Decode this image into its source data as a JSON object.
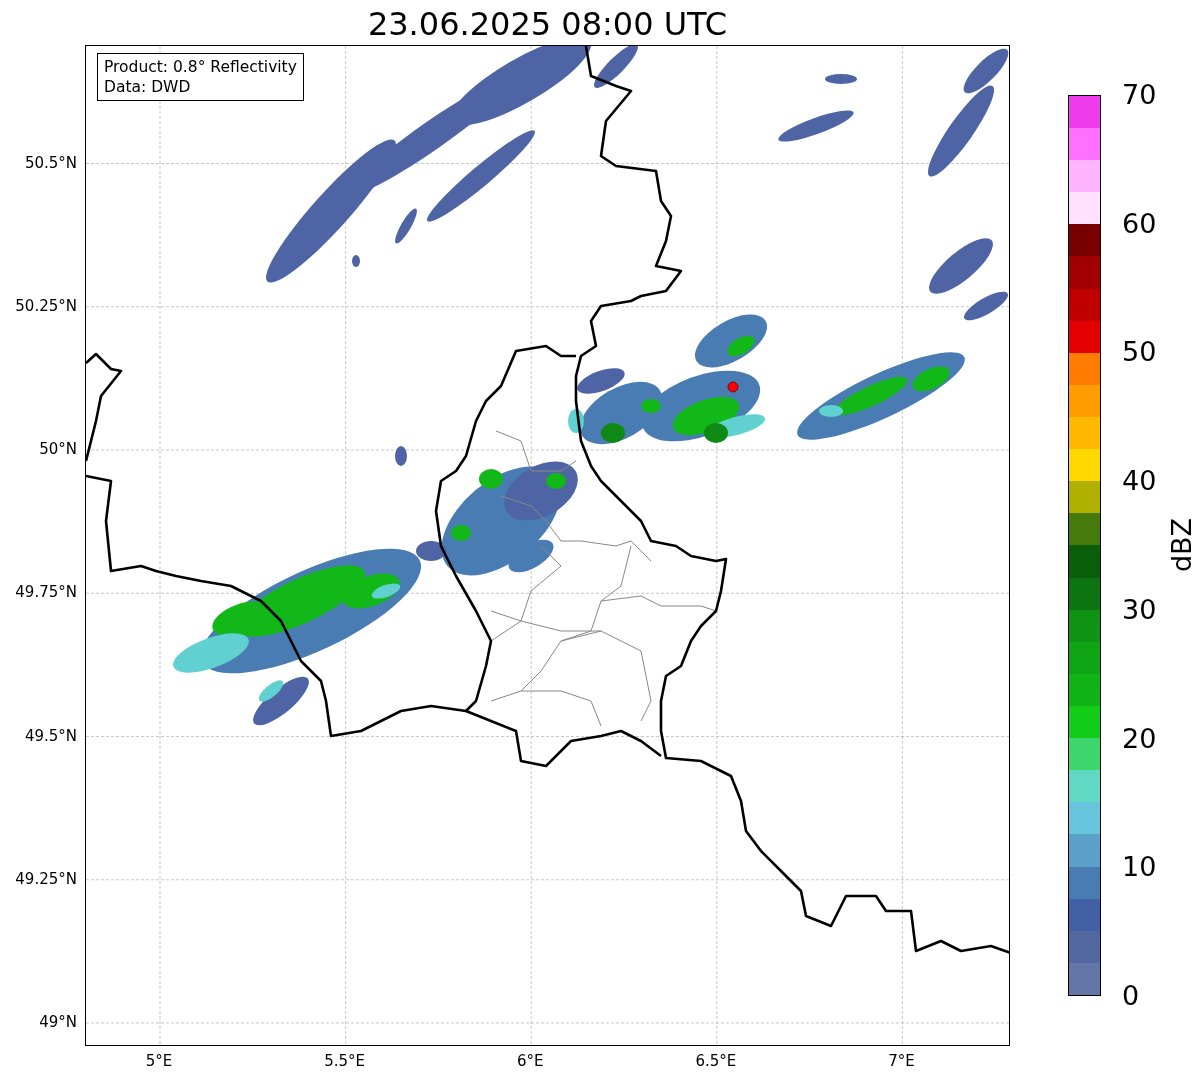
{
  "title": "23.06.2025 08:00 UTC",
  "info_box": {
    "lines": [
      "Product: 0.8° Reflectivity",
      "Data: DWD"
    ]
  },
  "map": {
    "lat_labels": [
      "50.5°N",
      "50.25°N",
      "50°N",
      "49.75°N",
      "49.5°N",
      "49.25°N",
      "49°N"
    ],
    "lon_labels": [
      "5°E",
      "5.5°E",
      "6°E",
      "6.5°E",
      "7°E"
    ]
  },
  "colorbar": {
    "label": "dBZ",
    "ticks": [
      "70",
      "60",
      "50",
      "40",
      "30",
      "20",
      "10",
      "0"
    ],
    "segments": [
      {
        "color": "#6476a8"
      },
      {
        "color": "#5468a0"
      },
      {
        "color": "#4460a4"
      },
      {
        "color": "#4a7cb4"
      },
      {
        "color": "#5aa0c8"
      },
      {
        "color": "#68c4dc"
      },
      {
        "color": "#60d8c4"
      },
      {
        "color": "#3cd66c"
      },
      {
        "color": "#12cc18"
      },
      {
        "color": "#10b416"
      },
      {
        "color": "#0ea414"
      },
      {
        "color": "#0e9412"
      },
      {
        "color": "#0c7410"
      },
      {
        "color": "#0a5e0a"
      },
      {
        "color": "#467a0a"
      },
      {
        "color": "#b0b000"
      },
      {
        "color": "#ffd800"
      },
      {
        "color": "#ffb800"
      },
      {
        "color": "#ff9c00"
      },
      {
        "color": "#ff7c00"
      },
      {
        "color": "#e40000"
      },
      {
        "color": "#c00000"
      },
      {
        "color": "#a00000"
      },
      {
        "color": "#780000"
      },
      {
        "color": "#ffe0ff"
      },
      {
        "color": "#ffb4ff"
      },
      {
        "color": "#ff70ff"
      },
      {
        "color": "#ee3cee"
      }
    ]
  }
}
